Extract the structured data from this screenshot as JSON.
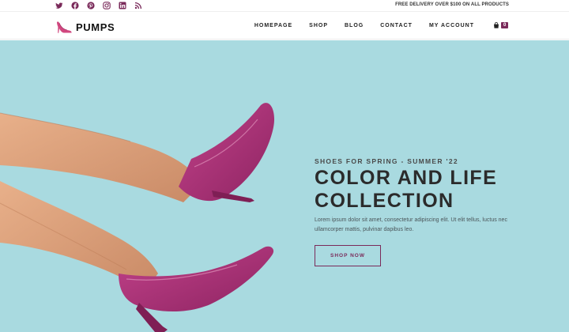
{
  "topbar": {
    "social_icons": [
      "twitter-icon",
      "facebook-icon",
      "pinterest-icon",
      "instagram-icon",
      "linkedin-icon",
      "rss-icon"
    ],
    "shipping_note": "FREE DELIVERY OVER $100 ON ALL PRODUCTS"
  },
  "header": {
    "logo_text": "PUMPS",
    "nav": [
      "HOMEPAGE",
      "SHOP",
      "BLOG",
      "CONTACT",
      "MY ACCOUNT"
    ],
    "cart_count": "0"
  },
  "hero": {
    "eyebrow": "SHOES FOR SPRING - SUMMER '22",
    "headline_line1": "COLOR AND LIFE",
    "headline_line2": "COLLECTION",
    "description": "Lorem ipsum dolor sit amet, consectetur adipiscing elit. Ut elit tellus, luctus nec ullamcorper mattis, pulvinar dapibus leo.",
    "cta_label": "SHOP NOW"
  },
  "colors": {
    "accent": "#7a2a5a",
    "hero_background": "#a9dae0",
    "shoe": "#b0357a"
  }
}
